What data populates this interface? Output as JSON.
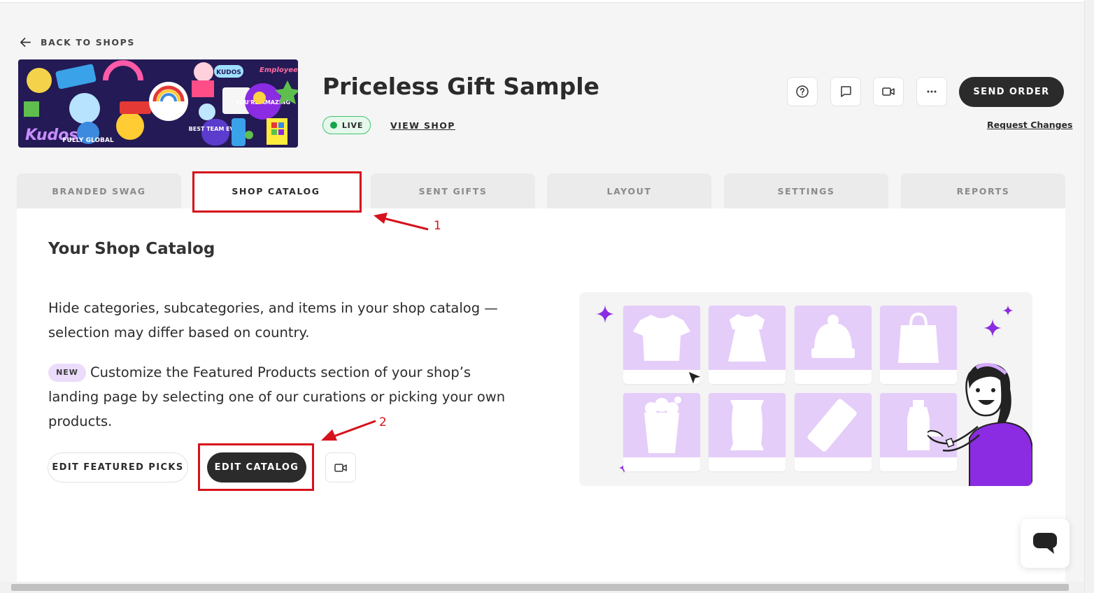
{
  "nav": {
    "back_label": "BACK TO SHOPS"
  },
  "shop": {
    "title": "Priceless Gift Sample",
    "status": "LIVE",
    "view_shop": "VIEW SHOP",
    "send_order": "SEND ORDER",
    "request_changes": "Request Changes",
    "banner_text": [
      "Kudos",
      "KUDOS",
      "BEST TEAM EVER",
      "FULLY GLOBAL",
      "Employee Engagement",
      "YOU'RE AMAZING"
    ]
  },
  "header_icons": [
    "help-icon",
    "chat-bubble-icon",
    "video-icon",
    "more-icon"
  ],
  "tabs": [
    {
      "label": "BRANDED SWAG"
    },
    {
      "label": "SHOP CATALOG"
    },
    {
      "label": "SENT GIFTS"
    },
    {
      "label": "LAYOUT"
    },
    {
      "label": "SETTINGS"
    },
    {
      "label": "REPORTS"
    }
  ],
  "active_tab": "SHOP CATALOG",
  "catalog": {
    "title": "Your Shop Catalog",
    "description": "Hide categories, subcategories, and items in your shop catalog —selection may differ based on country.",
    "new_badge": "NEW",
    "featured_text": "Customize the Featured Products section of your shop’s landing page by selecting one of our curations or picking your own products.",
    "edit_featured": "EDIT FEATURED PICKS",
    "edit_catalog": "EDIT CATALOG"
  },
  "annotations": {
    "step1": "1",
    "step2": "2"
  },
  "colors": {
    "accent_purple": "#8b2be2",
    "card_purple": "#e5cdf9",
    "annotation_red": "#d6121c",
    "live_green": "#16a34a",
    "dark": "#2b2b2b"
  }
}
